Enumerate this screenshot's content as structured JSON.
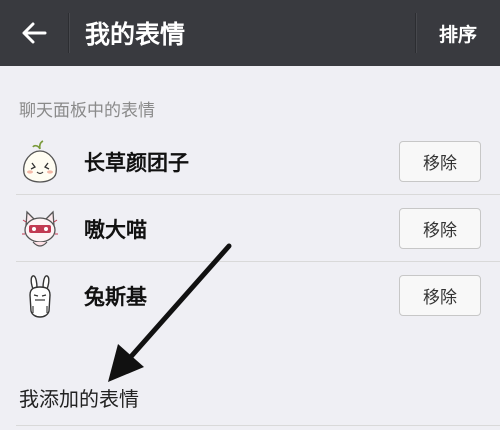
{
  "header": {
    "back_icon": "arrow-left-icon",
    "title": "我的表情",
    "sort_label": "排序",
    "bg_color": "#393a3f"
  },
  "panel_section": {
    "title": "聊天面板中的表情",
    "items": [
      {
        "name": "长草颜团子",
        "icon": "dumpling-sticker-icon",
        "remove_label": "移除"
      },
      {
        "name": "嗷大喵",
        "icon": "cat-sticker-icon",
        "remove_label": "移除"
      },
      {
        "name": "兔斯基",
        "icon": "rabbit-sticker-icon",
        "remove_label": "移除"
      }
    ]
  },
  "added_section": {
    "title": "我添加的表情"
  },
  "annotation": {
    "icon": "pointer-arrow-icon",
    "color": "#111111"
  }
}
